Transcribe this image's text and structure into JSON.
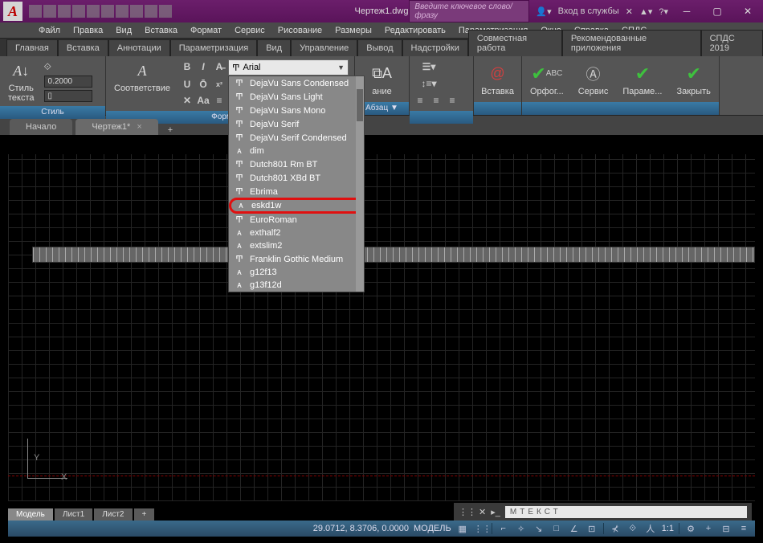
{
  "title": "Чертеж1.dwg",
  "search_placeholder": "Введите ключевое слово/фразу",
  "login_label": "Вход в службы",
  "menubar": [
    "Файл",
    "Правка",
    "Вид",
    "Вставка",
    "Формат",
    "Сервис",
    "Рисование",
    "Размеры",
    "Редактировать",
    "Параметризация",
    "Окно",
    "Справка",
    "СПДС"
  ],
  "ribbon_tabs": [
    "Главная",
    "Вставка",
    "Аннотации",
    "Параметризация",
    "Вид",
    "Управление",
    "Вывод",
    "Надстройки",
    "Совместная работа",
    "Рекомендованные приложения",
    "СПДС 2019"
  ],
  "panels": {
    "style": {
      "title": "Стиль",
      "label": "Стиль\nтекста",
      "height": "0.2000"
    },
    "format": {
      "title": "Форматир",
      "label": "Соответствие",
      "font": "Arial",
      "fonts": [
        "DejaVu Sans Condensed",
        "DejaVu Sans Light",
        "DejaVu Sans Mono",
        "DejaVu Serif",
        "DejaVu Serif Condensed",
        "dim",
        "Dutch801 Rm BT",
        "Dutch801 XBd BT",
        "Ebrima",
        "eskd1w",
        "EuroRoman",
        "exthalf2",
        "extslim2",
        "Franklin Gothic Medium",
        "g12f13",
        "g13f12d"
      ],
      "highlight_index": 9
    },
    "paragraph": {
      "title": "Абзац ▼",
      "label": "ание"
    },
    "insert": {
      "title": "",
      "label": "Вставка"
    },
    "spell": {
      "label": "Орфог..."
    },
    "service": {
      "label": "Сервис"
    },
    "params": {
      "label": "Параме..."
    },
    "close": {
      "label": "Закрыть"
    }
  },
  "doc_tabs": [
    {
      "label": "Начало",
      "active": false
    },
    {
      "label": "Чертеж1*",
      "active": true
    }
  ],
  "layout_tabs": [
    "Модель",
    "Лист1",
    "Лист2"
  ],
  "command": "МТЕКСТ",
  "status": {
    "coords": "29.0712, 8.3706, 0.0000",
    "model": "МОДЕЛЬ",
    "scale": "1:1"
  },
  "ucs": {
    "x": "X",
    "y": "Y"
  }
}
